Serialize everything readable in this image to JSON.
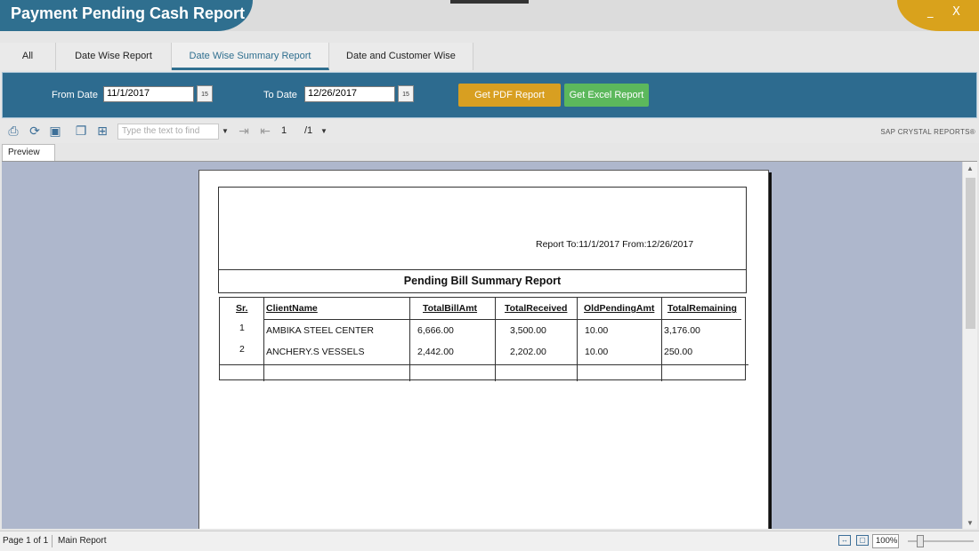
{
  "window": {
    "title": "Payment Pending Cash Report",
    "minimize_glyph": "_",
    "close_glyph": "X"
  },
  "tabs": [
    {
      "label": "All",
      "active": false
    },
    {
      "label": "Date Wise Report",
      "active": false
    },
    {
      "label": "Date Wise Summary Report",
      "active": true
    },
    {
      "label": "Date and Customer Wise",
      "active": false
    }
  ],
  "filters": {
    "from_label": "From Date",
    "from_value": "11/1/2017",
    "to_label": "To Date",
    "to_value": "12/26/2017",
    "calendar_glyph": "15",
    "pdf_button": "Get PDF Report",
    "excel_button": "Get Excel Report"
  },
  "viewer_toolbar": {
    "search_placeholder": "Type the text to find",
    "current_page": "1",
    "total_pages": "/1",
    "brand": "SAP CRYSTAL REPORTS®",
    "icons": [
      "print-icon",
      "refresh-icon",
      "export-icon",
      "copy-icon",
      "group-tree-icon",
      "next-page-icon",
      "prev-page-icon"
    ]
  },
  "preview_tab": "Preview",
  "report": {
    "date_range": "Report To:11/1/2017 From:12/26/2017",
    "title": "Pending Bill Summary Report",
    "columns": [
      "Sr.",
      "ClientName",
      "TotalBillAmt",
      "TotalReceived",
      "OldPendingAmt",
      "TotalRemaining"
    ],
    "rows": [
      [
        "1",
        "AMBIKA STEEL CENTER",
        "6,666.00",
        "3,500.00",
        "10.00",
        "3,176.00"
      ],
      [
        "2",
        "ANCHERY.S VESSELS",
        "2,442.00",
        "2,202.00",
        "10.00",
        "250.00"
      ]
    ]
  },
  "statusbar": {
    "page_info": "Page 1 of 1",
    "report_name": "Main Report",
    "zoom": "100%"
  },
  "colors": {
    "brand_blue": "#2f6f8f",
    "accent_gold": "#d89f21",
    "excel_green": "#5cb85c",
    "preview_bg": "#aeb7cc"
  }
}
